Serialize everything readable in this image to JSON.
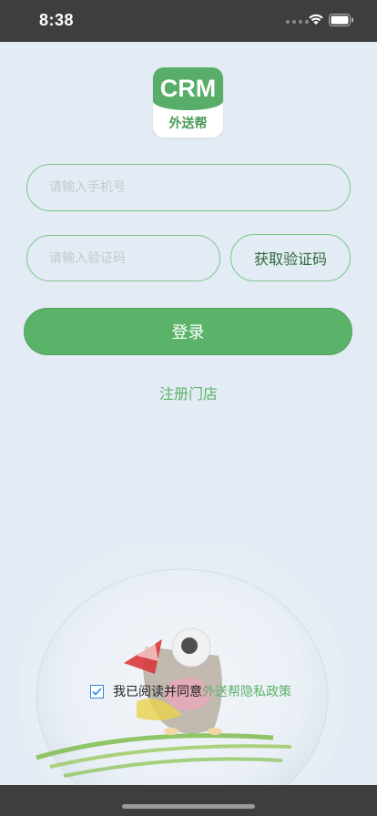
{
  "status": {
    "time": "8:38"
  },
  "logo": {
    "title": "CRM",
    "subtitle": "外送帮"
  },
  "form": {
    "phone_placeholder": "请输入手机号",
    "code_placeholder": "请输入验证码",
    "get_code_label": "获取验证码",
    "login_label": "登录",
    "register_label": "注册门店"
  },
  "agreement": {
    "checked": true,
    "text": "我已阅读并同意",
    "policy_link": "外送帮隐私政策"
  },
  "colors": {
    "accent": "#5bb36a",
    "background": "#e3ebf4",
    "system_bar": "#3e3e3e"
  }
}
